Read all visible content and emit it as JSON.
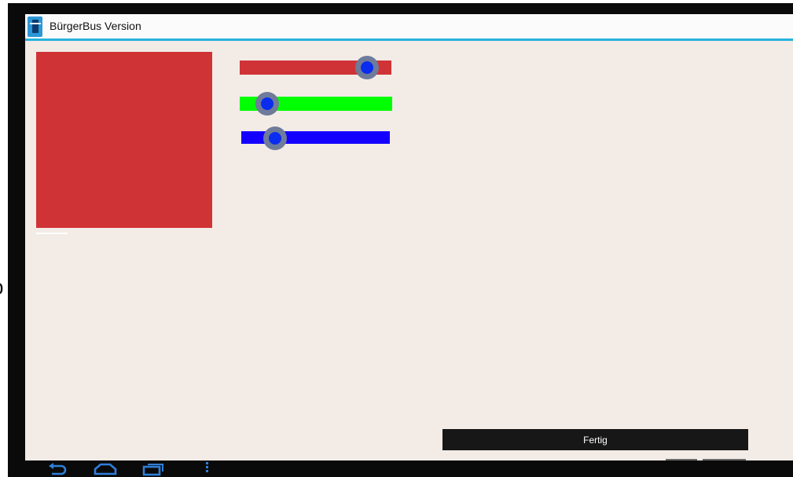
{
  "titlebar": {
    "title": "BürgerBus Version",
    "icon": "bus-app-icon",
    "divider_color": "#27b2dd"
  },
  "preview": {
    "color": "#d03336",
    "label": "color-preview-swatch"
  },
  "sliders": [
    {
      "channel": "red",
      "track_color": "#d03336",
      "value_fraction": 0.84
    },
    {
      "channel": "green",
      "track_color": "#00ff00",
      "value_fraction": 0.18
    },
    {
      "channel": "blue",
      "track_color": "#1400ff",
      "value_fraction": 0.23
    }
  ],
  "thumb": {
    "ring_color": "#6e7b9a",
    "dot_color": "#0a2cee"
  },
  "actions": {
    "fertig_label": "Fertig"
  },
  "navbar": {
    "icon_color": "#2f7fd8",
    "buttons": [
      "back-icon",
      "home-icon",
      "recent-apps-icon",
      "overflow-menu-icon"
    ]
  },
  "edge_glyph": "b"
}
